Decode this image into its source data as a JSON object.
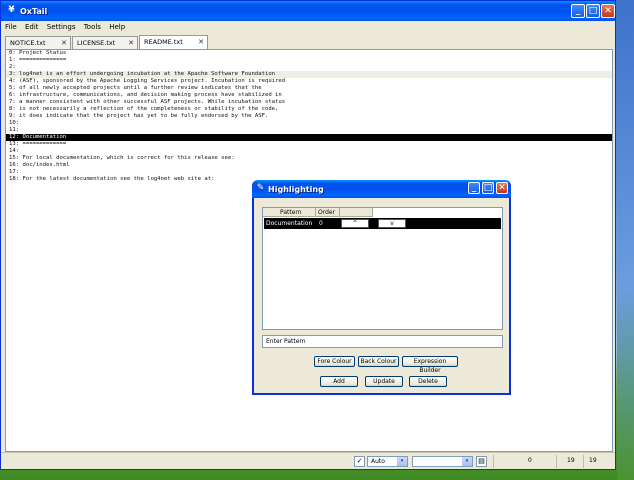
{
  "window": {
    "title": "OxTail",
    "min_glyph": "_",
    "max_glyph": "□",
    "close_glyph": "✕",
    "app_glyph": "¥"
  },
  "menu": [
    "File",
    "Edit",
    "Settings",
    "Tools",
    "Help"
  ],
  "tabs": [
    {
      "label": "NOTICE.txt"
    },
    {
      "label": "LICENSE.txt"
    },
    {
      "label": "README.txt"
    }
  ],
  "tab_close": "✕",
  "editor": {
    "lines": [
      "0: Project Status",
      "1: ==============",
      "2:",
      "3: log4net is an effort undergoing incubation at the Apache Software Foundation",
      "4: (ASF), sponsored by the Apache Logging Services project. Incubation is required",
      "5: of all newly accepted projects until a further review indicates that the",
      "6: infrastructure, communications, and decision making process have stabilized in",
      "7: a manner consistent with other successful ASF projects. While incubation status",
      "8: is not necessarily a reflection of the completeness or stability of the code,",
      "9: it does indicate that the project has yet to be fully endorsed by the ASF.",
      "10:",
      "11:",
      "12: Documentation",
      "13: =============",
      "14:",
      "15: For local documentation, which is correct for this release see:",
      "16: doc/index.html",
      "17:",
      "18: For the latest documentation see the log4net web site at:"
    ]
  },
  "status": {
    "auto_label": "Auto",
    "combo_value": "",
    "pos1": "0",
    "pos2": "19",
    "pos3": "19",
    "checkbox_glyph": "✓",
    "dropdown_glyph": "▾",
    "filter_glyph": "▤"
  },
  "dialog": {
    "title": "Highlighting",
    "app_glyph": "✎",
    "columns": {
      "pattern": "Pattern",
      "order": "Order"
    },
    "rows": [
      {
        "pattern": "Documentation",
        "order": "0",
        "up": "^",
        "down": "v"
      }
    ],
    "input_placeholder": "Enter Pattern",
    "buttons": {
      "fore": "Fore Colour",
      "back": "Back Colour",
      "expr": "Expression Builder",
      "add": "Add",
      "update": "Update",
      "delete": "Delete"
    }
  },
  "colors": {
    "title_blue": "#0050ee",
    "highlight": "#000000",
    "window_bg": "#ece9d8"
  }
}
